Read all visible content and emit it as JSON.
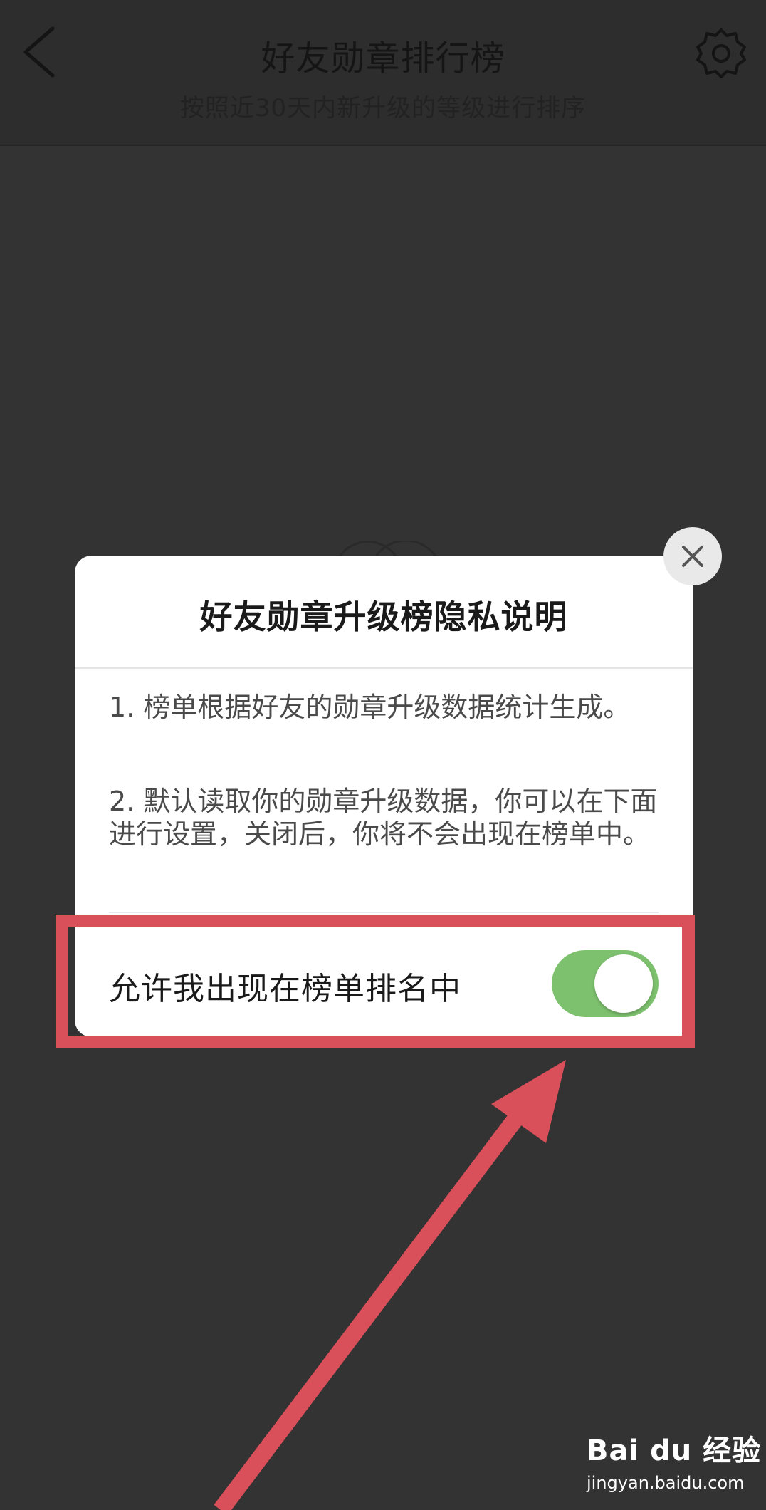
{
  "header": {
    "title": "好友勋章排行榜",
    "subtitle": "按照近30天内新升级的等级进行排序",
    "back_icon": "chevron-left-icon",
    "settings_icon": "gear-icon"
  },
  "dialog": {
    "title": "好友勋章升级榜隐私说明",
    "paragraph_1": "1. 榜单根据好友的勋章升级数据统计生成。",
    "paragraph_2": "2. 默认读取你的勋章升级数据，你可以在下面进行设置，关闭后，你将不会出现在榜单中。",
    "setting_label": "允许我出现在榜单排名中",
    "toggle_on": true,
    "close_icon": "close-icon"
  },
  "watermark": {
    "logo": "Bai du 经验",
    "url": "jingyan.baidu.com"
  },
  "colors": {
    "background": "#333333",
    "dialog": "#ffffff",
    "toggle_on": "#7dc16e",
    "annotation": "#d94f5a"
  }
}
